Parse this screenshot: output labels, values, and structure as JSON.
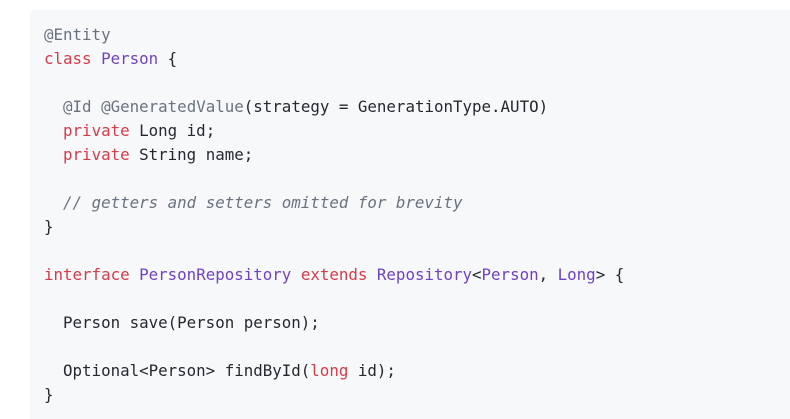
{
  "code_block": {
    "language": "java",
    "colors": {
      "background": "#f6f8fa",
      "plain": "#24292e",
      "keyword": "#d73a49",
      "type": "#6f42c1",
      "annotation": "#6a737d",
      "comment": "#6a737d"
    },
    "lines": [
      [
        {
          "t": "annotation",
          "v": "@Entity"
        }
      ],
      [
        {
          "t": "keyword",
          "v": "class"
        },
        {
          "t": "plain",
          "v": " "
        },
        {
          "t": "type",
          "v": "Person"
        },
        {
          "t": "plain",
          "v": " {"
        }
      ],
      [],
      [
        {
          "t": "plain",
          "v": "  "
        },
        {
          "t": "annotation",
          "v": "@Id"
        },
        {
          "t": "plain",
          "v": " "
        },
        {
          "t": "annotation",
          "v": "@GeneratedValue"
        },
        {
          "t": "plain",
          "v": "(strategy = GenerationType.AUTO)"
        }
      ],
      [
        {
          "t": "plain",
          "v": "  "
        },
        {
          "t": "keyword",
          "v": "private"
        },
        {
          "t": "plain",
          "v": " Long id;"
        }
      ],
      [
        {
          "t": "plain",
          "v": "  "
        },
        {
          "t": "keyword",
          "v": "private"
        },
        {
          "t": "plain",
          "v": " String name;"
        }
      ],
      [],
      [
        {
          "t": "plain",
          "v": "  "
        },
        {
          "t": "comment",
          "v": "// getters and setters omitted for brevity"
        }
      ],
      [
        {
          "t": "plain",
          "v": "}"
        }
      ],
      [],
      [
        {
          "t": "keyword",
          "v": "interface"
        },
        {
          "t": "plain",
          "v": " "
        },
        {
          "t": "type",
          "v": "PersonRepository"
        },
        {
          "t": "plain",
          "v": " "
        },
        {
          "t": "keyword",
          "v": "extends"
        },
        {
          "t": "plain",
          "v": " "
        },
        {
          "t": "type",
          "v": "Repository"
        },
        {
          "t": "plain",
          "v": "<"
        },
        {
          "t": "type",
          "v": "Person"
        },
        {
          "t": "plain",
          "v": ", "
        },
        {
          "t": "type",
          "v": "Long"
        },
        {
          "t": "plain",
          "v": "> {"
        }
      ],
      [],
      [
        {
          "t": "plain",
          "v": "  Person save(Person person);"
        }
      ],
      [],
      [
        {
          "t": "plain",
          "v": "  Optional<Person> findById("
        },
        {
          "t": "keyword",
          "v": "long"
        },
        {
          "t": "plain",
          "v": " id);"
        }
      ],
      [
        {
          "t": "plain",
          "v": "}"
        }
      ]
    ]
  }
}
